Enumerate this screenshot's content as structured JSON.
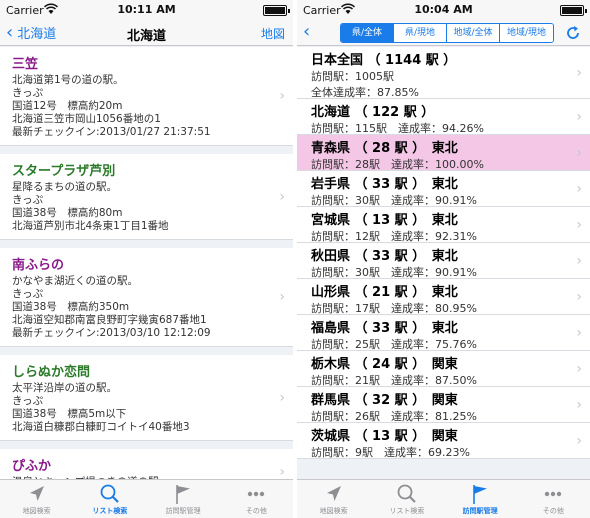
{
  "left": {
    "status": {
      "carrier": "Carrier",
      "time": "10:11 AM"
    },
    "nav": {
      "back_label": "北海道",
      "title": "北海道",
      "right_label": "地図"
    },
    "stations": [
      {
        "name": "三笠",
        "name_color": "#8a1a8a",
        "lines": [
          "北海道第1号の道の駅。",
          "きっぷ",
          "国道12号　標高約20m",
          "北海道三笠市岡山1056番地の1",
          "最新チェックイン:2013/01/27 21:37:51"
        ]
      },
      {
        "name": "スタープラザ芦別",
        "name_color": "#2a7a2a",
        "lines": [
          "星降るまちの道の駅。",
          "きっぷ",
          "国道38号　標高約80m",
          "北海道芦別市北4条東1丁目1番地"
        ]
      },
      {
        "name": "南ふらの",
        "name_color": "#8a1a8a",
        "lines": [
          "かなやま湖近くの道の駅。",
          "きっぷ",
          "国道38号　標高約350m",
          "北海道空知郡南富良野町字幾寅687番地1",
          "最新チェックイン:2013/03/10 12:12:09"
        ]
      },
      {
        "name": "しらぬか恋問",
        "name_color": "#2a7a2a",
        "lines": [
          "太平洋沿岸の道の駅。",
          "きっぷ",
          "国道38号　標高5m以下",
          "北海道白糠郡白糠町コイトイ40番地3"
        ]
      },
      {
        "name": "ぴふか",
        "name_color": "#8a1a8a",
        "lines": [
          "温泉とキャンプ場つきの道の駅。"
        ]
      }
    ],
    "tabs": [
      {
        "label": "地図検索",
        "icon": "location-arrow-icon",
        "active": false
      },
      {
        "label": "リスト検索",
        "icon": "magnifier-icon",
        "active": true
      },
      {
        "label": "訪問駅管理",
        "icon": "flag-icon",
        "active": false
      },
      {
        "label": "その他",
        "icon": "more-dots-icon",
        "active": false
      }
    ]
  },
  "right": {
    "status": {
      "carrier": "Carrier",
      "time": "10:04 AM"
    },
    "segments": [
      {
        "label": "県/全体",
        "active": true
      },
      {
        "label": "県/現地",
        "active": false
      },
      {
        "label": "地域/全体",
        "active": false
      },
      {
        "label": "地域/現地",
        "active": false
      }
    ],
    "prefectures": [
      {
        "title": "日本全国 （ 1144 駅 ）",
        "line1": "訪問駅：1005駅",
        "line2": "全体達成率：87.85%",
        "highlight": false
      },
      {
        "title": "北海道 （ 122 駅 ）",
        "line1": "訪問駅：115駅　達成率：94.26%",
        "line2": "",
        "highlight": false
      },
      {
        "title": "青森県 （ 28 駅 ）　東北",
        "line1": "訪問駅：28駅　達成率：100.00%",
        "line2": "",
        "highlight": true
      },
      {
        "title": "岩手県 （ 33 駅 ）　東北",
        "line1": "訪問駅：30駅　達成率：90.91%",
        "line2": "",
        "highlight": false
      },
      {
        "title": "宮城県 （ 13 駅 ）　東北",
        "line1": "訪問駅：12駅　達成率：92.31%",
        "line2": "",
        "highlight": false
      },
      {
        "title": "秋田県 （ 33 駅 ）　東北",
        "line1": "訪問駅：30駅　達成率：90.91%",
        "line2": "",
        "highlight": false
      },
      {
        "title": "山形県 （ 21 駅 ）　東北",
        "line1": "訪問駅：17駅　達成率：80.95%",
        "line2": "",
        "highlight": false
      },
      {
        "title": "福島県 （ 33 駅 ）　東北",
        "line1": "訪問駅：25駅　達成率：75.76%",
        "line2": "",
        "highlight": false
      },
      {
        "title": "栃木県 （ 24 駅 ）　関東",
        "line1": "訪問駅：21駅　達成率：87.50%",
        "line2": "",
        "highlight": false
      },
      {
        "title": "群馬県 （ 32 駅 ）　関東",
        "line1": "訪問駅：26駅　達成率：81.25%",
        "line2": "",
        "highlight": false
      },
      {
        "title": "茨城県 （ 13 駅 ）　関東",
        "line1": "訪問駅：9駅　達成率：69.23%",
        "line2": "",
        "highlight": false
      }
    ],
    "tabs": [
      {
        "label": "地図検索",
        "icon": "location-arrow-icon",
        "active": false
      },
      {
        "label": "リスト検索",
        "icon": "magnifier-icon",
        "active": false
      },
      {
        "label": "訪問駅管理",
        "icon": "flag-icon",
        "active": true
      },
      {
        "label": "その他",
        "icon": "more-dots-icon",
        "active": false
      }
    ]
  },
  "colors": {
    "accent": "#1a7ce8",
    "highlight_row": "#f4c7e6",
    "inactive_tab": "#8e8e93"
  }
}
